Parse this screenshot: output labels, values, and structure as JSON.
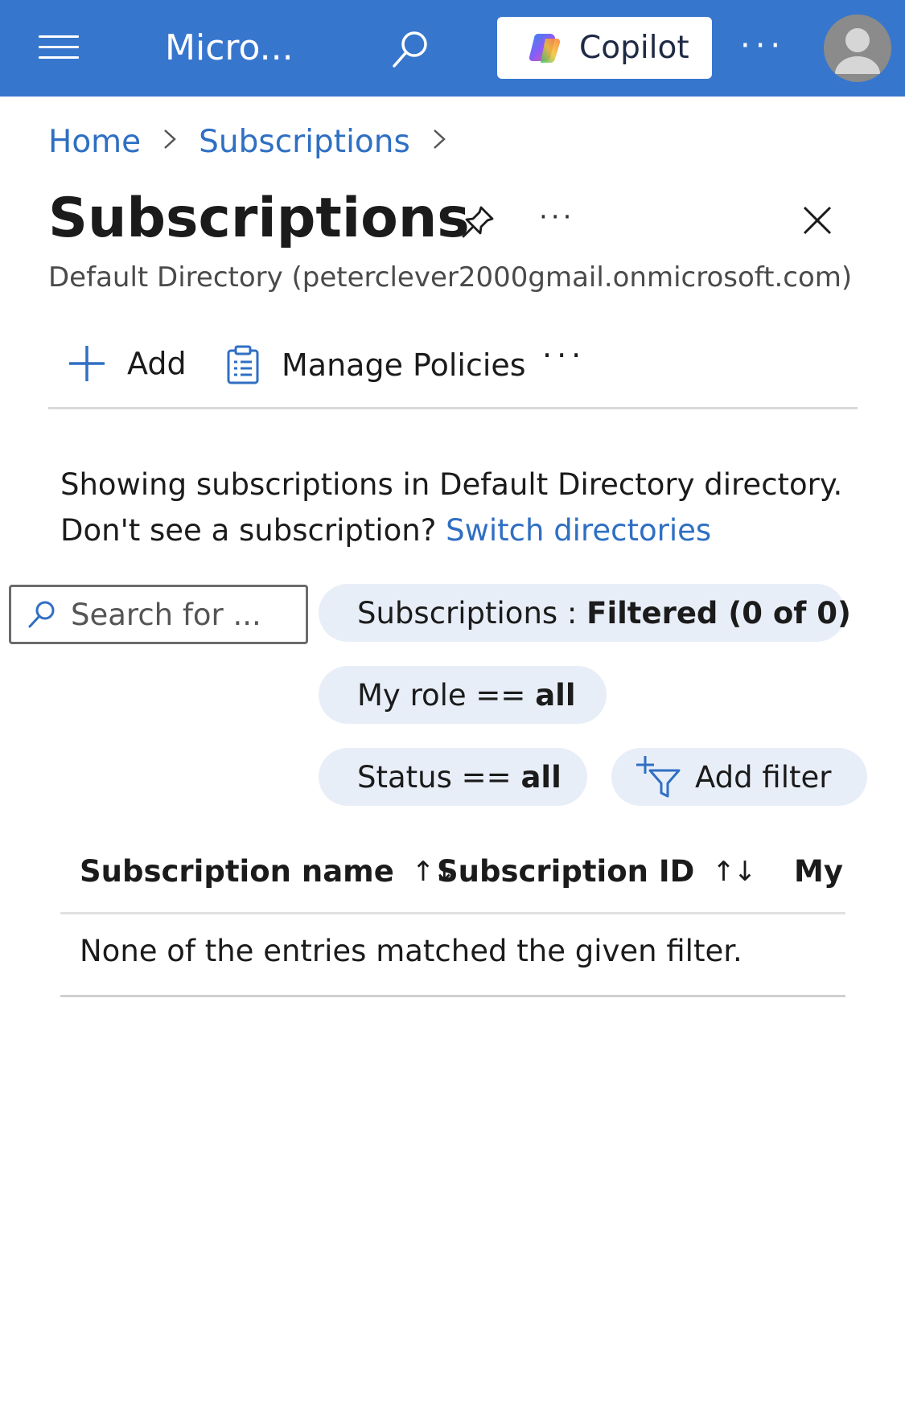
{
  "topbar": {
    "app_title": "Micro...",
    "copilot_label": "Copilot",
    "more": "···"
  },
  "breadcrumb": {
    "home": "Home",
    "subscriptions": "Subscriptions"
  },
  "page": {
    "title": "Subscriptions",
    "more": "···",
    "subtitle": "Default Directory (peterclever2000gmail.onmicrosoft.com)"
  },
  "toolbar": {
    "add_label": "Add",
    "manage_policies_label": "Manage Policies",
    "more": "···"
  },
  "info": {
    "line1": "Showing subscriptions in Default Directory directory.",
    "line2_prefix": "Don't see a subscription? ",
    "switch_link": "Switch directories"
  },
  "search": {
    "placeholder": "Search for ..."
  },
  "filters": {
    "subscriptions_key": "Subscriptions : ",
    "subscriptions_value": "Filtered (0 of 0)",
    "role_key": "My role == ",
    "role_value": "all",
    "status_key": "Status == ",
    "status_value": "all",
    "add_filter_label": "Add filter"
  },
  "table": {
    "columns": [
      "Subscription name",
      "Subscription ID",
      "My"
    ],
    "sort_glyph": "↑↓",
    "empty_message": "None of the entries matched the given filter."
  },
  "colors": {
    "topbar_bg": "#3776cd",
    "link": "#2f6fc3",
    "pill_bg": "#e8eef8"
  }
}
